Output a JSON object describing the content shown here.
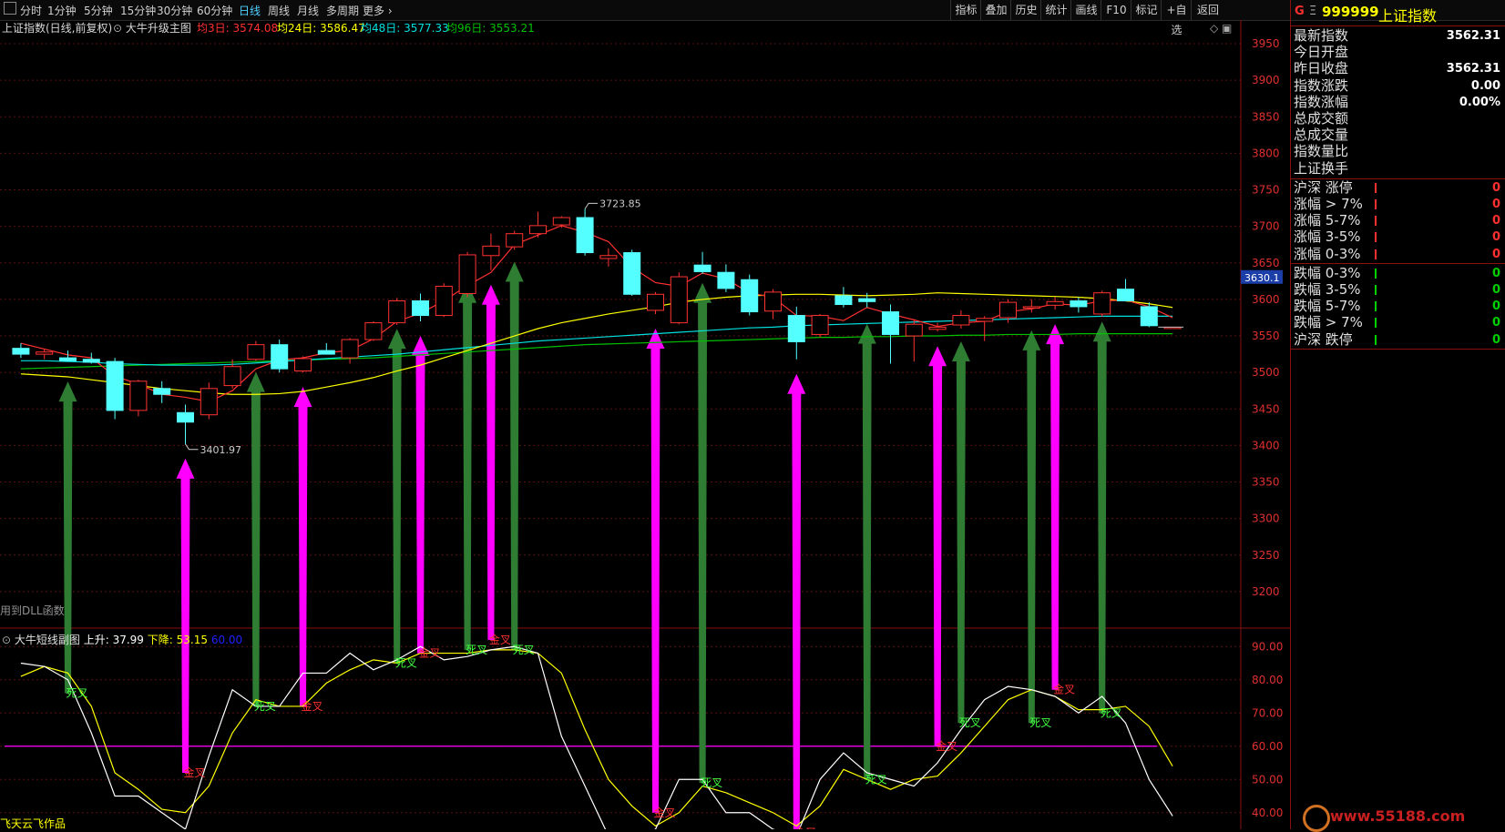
{
  "toolbar": {
    "periods": [
      "分时",
      "1分钟",
      "5分钟",
      "15分钟",
      "30分钟",
      "60分钟",
      "日线",
      "周线",
      "月线",
      "多周期",
      "更多"
    ],
    "active_period": "日线",
    "tools": [
      "指标",
      "叠加",
      "历史",
      "统计",
      "画线",
      "F10",
      "标记",
      "+自选",
      "返回"
    ]
  },
  "main_legend": {
    "index_name": "上证指数(日线,前复权)",
    "template": "大牛升级主图",
    "ma3": "均3日: 3574.08",
    "ma24": "均24日: 3586.47",
    "ma48": "均48日: 3577.33",
    "ma96": "均96日: 3553.21"
  },
  "sub_legend": {
    "name": "大牛短线副图",
    "up": "上升: 37.99",
    "down": "下降: 53.15",
    "level": "60.00"
  },
  "annotations": {
    "high": "3723.85",
    "low": "3401.97",
    "dll_note": "用到DLL函数",
    "author": "飞天云飞作品",
    "price_tag": "3630.1",
    "watermark": "www.55188.com"
  },
  "price_axis": [
    3950,
    3900,
    3850,
    3800,
    3750,
    3700,
    3650,
    3600,
    3550,
    3500,
    3450,
    3400,
    3350,
    3300,
    3250,
    3200
  ],
  "osc_axis": [
    90.0,
    80.0,
    70.0,
    60.0,
    50.0,
    40.0
  ],
  "right_panel": {
    "title_code": "999999",
    "title_name": "上证指数",
    "quote": [
      {
        "label": "最新指数",
        "value": "3562.31"
      },
      {
        "label": "今日开盘",
        "value": ""
      },
      {
        "label": "昨日收盘",
        "value": "3562.31"
      },
      {
        "label": "指数涨跌",
        "value": "0.00"
      },
      {
        "label": "指数涨幅",
        "value": "0.00%"
      },
      {
        "label": "总成交额",
        "value": ""
      },
      {
        "label": "总成交量",
        "value": ""
      },
      {
        "label": "指数量比",
        "value": ""
      },
      {
        "label": "上证换手",
        "value": ""
      }
    ],
    "up_stats": [
      {
        "label": "沪深 涨停",
        "value": "0"
      },
      {
        "label": "涨幅 > 7%",
        "value": "0"
      },
      {
        "label": "涨幅 5-7%",
        "value": "0"
      },
      {
        "label": "涨幅 3-5%",
        "value": "0"
      },
      {
        "label": "涨幅 0-3%",
        "value": "0"
      }
    ],
    "down_stats": [
      {
        "label": "跌幅 0-3%",
        "value": "0"
      },
      {
        "label": "跌幅 3-5%",
        "value": "0"
      },
      {
        "label": "跌幅 5-7%",
        "value": "0"
      },
      {
        "label": "跌幅 > 7%",
        "value": "0"
      },
      {
        "label": "沪深 跌停",
        "value": "0"
      }
    ]
  },
  "colors": {
    "up": "#ff3232",
    "down": "#54ffff",
    "ma3": "#ff3030",
    "ma24": "#ffff00",
    "ma48": "#00e0e0",
    "ma96": "#00c000",
    "golden_arrow": "#ff00ff",
    "dead_arrow": "#2e7d32",
    "osc_up": "#ffffff",
    "osc_down": "#ffff00",
    "level": "#ff00ff"
  },
  "chart_data": {
    "type": "candlestick",
    "candles": [
      {
        "o": 3533,
        "h": 3540,
        "l": 3520,
        "c": 3525
      },
      {
        "o": 3525,
        "h": 3532,
        "l": 3518,
        "c": 3528
      },
      {
        "o": 3520,
        "h": 3530,
        "l": 3515,
        "c": 3516
      },
      {
        "o": 3518,
        "h": 3527,
        "l": 3512,
        "c": 3514
      },
      {
        "o": 3515,
        "h": 3520,
        "l": 3436,
        "c": 3448
      },
      {
        "o": 3448,
        "h": 3490,
        "l": 3440,
        "c": 3488
      },
      {
        "o": 3478,
        "h": 3488,
        "l": 3458,
        "c": 3470
      },
      {
        "o": 3445,
        "h": 3456,
        "l": 3402,
        "c": 3432
      },
      {
        "o": 3442,
        "h": 3486,
        "l": 3436,
        "c": 3478
      },
      {
        "o": 3482,
        "h": 3518,
        "l": 3478,
        "c": 3508
      },
      {
        "o": 3518,
        "h": 3543,
        "l": 3516,
        "c": 3538
      },
      {
        "o": 3538,
        "h": 3545,
        "l": 3500,
        "c": 3505
      },
      {
        "o": 3502,
        "h": 3522,
        "l": 3500,
        "c": 3519
      },
      {
        "o": 3530,
        "h": 3540,
        "l": 3525,
        "c": 3525
      },
      {
        "o": 3520,
        "h": 3547,
        "l": 3512,
        "c": 3545
      },
      {
        "o": 3545,
        "h": 3570,
        "l": 3543,
        "c": 3568
      },
      {
        "o": 3568,
        "h": 3602,
        "l": 3565,
        "c": 3598
      },
      {
        "o": 3598,
        "h": 3608,
        "l": 3570,
        "c": 3578
      },
      {
        "o": 3578,
        "h": 3622,
        "l": 3576,
        "c": 3618
      },
      {
        "o": 3608,
        "h": 3665,
        "l": 3603,
        "c": 3661
      },
      {
        "o": 3660,
        "h": 3690,
        "l": 3640,
        "c": 3673
      },
      {
        "o": 3672,
        "h": 3694,
        "l": 3668,
        "c": 3690
      },
      {
        "o": 3690,
        "h": 3720,
        "l": 3685,
        "c": 3701
      },
      {
        "o": 3702,
        "h": 3714,
        "l": 3698,
        "c": 3712
      },
      {
        "o": 3712,
        "h": 3724,
        "l": 3660,
        "c": 3664
      },
      {
        "o": 3656,
        "h": 3670,
        "l": 3645,
        "c": 3660
      },
      {
        "o": 3664,
        "h": 3668,
        "l": 3605,
        "c": 3607
      },
      {
        "o": 3585,
        "h": 3610,
        "l": 3580,
        "c": 3607
      },
      {
        "o": 3568,
        "h": 3637,
        "l": 3566,
        "c": 3631
      },
      {
        "o": 3647,
        "h": 3665,
        "l": 3635,
        "c": 3638
      },
      {
        "o": 3637,
        "h": 3648,
        "l": 3610,
        "c": 3615
      },
      {
        "o": 3627,
        "h": 3634,
        "l": 3578,
        "c": 3583
      },
      {
        "o": 3584,
        "h": 3614,
        "l": 3573,
        "c": 3610
      },
      {
        "o": 3578,
        "h": 3590,
        "l": 3518,
        "c": 3542
      },
      {
        "o": 3552,
        "h": 3580,
        "l": 3548,
        "c": 3578
      },
      {
        "o": 3605,
        "h": 3617,
        "l": 3589,
        "c": 3593
      },
      {
        "o": 3601,
        "h": 3609,
        "l": 3589,
        "c": 3597
      },
      {
        "o": 3583,
        "h": 3593,
        "l": 3512,
        "c": 3552
      },
      {
        "o": 3550,
        "h": 3573,
        "l": 3515,
        "c": 3566
      },
      {
        "o": 3559,
        "h": 3568,
        "l": 3556,
        "c": 3562
      },
      {
        "o": 3565,
        "h": 3585,
        "l": 3560,
        "c": 3578
      },
      {
        "o": 3570,
        "h": 3577,
        "l": 3543,
        "c": 3574
      },
      {
        "o": 3575,
        "h": 3600,
        "l": 3568,
        "c": 3596
      },
      {
        "o": 3588,
        "h": 3600,
        "l": 3582,
        "c": 3590
      },
      {
        "o": 3592,
        "h": 3603,
        "l": 3586,
        "c": 3597
      },
      {
        "o": 3598,
        "h": 3603,
        "l": 3582,
        "c": 3590
      },
      {
        "o": 3580,
        "h": 3612,
        "l": 3576,
        "c": 3609
      },
      {
        "o": 3614,
        "h": 3628,
        "l": 3600,
        "c": 3598
      },
      {
        "o": 3590,
        "h": 3596,
        "l": 3562,
        "c": 3564
      },
      {
        "o": 3562,
        "h": 3562,
        "l": 3562,
        "c": 3562
      }
    ],
    "ma3": [
      3540,
      3532,
      3524,
      3520,
      3495,
      3484,
      3470,
      3466,
      3460,
      3475,
      3505,
      3517,
      3520,
      3527,
      3530,
      3546,
      3570,
      3581,
      3598,
      3619,
      3637,
      3675,
      3688,
      3701,
      3692,
      3679,
      3644,
      3623,
      3618,
      3636,
      3628,
      3609,
      3603,
      3578,
      3577,
      3571,
      3589,
      3580,
      3572,
      3563,
      3568,
      3570,
      3583,
      3587,
      3594,
      3592,
      3598,
      3599,
      3590,
      3575
    ],
    "ma24": [
      3498,
      3496,
      3494,
      3490,
      3486,
      3482,
      3478,
      3475,
      3472,
      3470,
      3470,
      3471,
      3474,
      3480,
      3486,
      3493,
      3502,
      3510,
      3520,
      3530,
      3540,
      3550,
      3560,
      3568,
      3574,
      3580,
      3585,
      3590,
      3596,
      3600,
      3603,
      3605,
      3606,
      3607,
      3607,
      3606,
      3605,
      3606,
      3607,
      3609,
      3608,
      3607,
      3606,
      3605,
      3604,
      3603,
      3601,
      3598,
      3594,
      3589
    ],
    "ma48": [
      3516,
      3516,
      3515,
      3514,
      3512,
      3511,
      3510,
      3510,
      3510,
      3511,
      3513,
      3515,
      3517,
      3519,
      3521,
      3523,
      3525,
      3528,
      3531,
      3534,
      3537,
      3540,
      3543,
      3545,
      3547,
      3549,
      3551,
      3553,
      3555,
      3557,
      3559,
      3561,
      3562,
      3564,
      3565,
      3566,
      3567,
      3568,
      3569,
      3570,
      3571,
      3572,
      3573,
      3574,
      3575,
      3576,
      3577,
      3577,
      3577,
      3577
    ],
    "ma96": [
      3505,
      3506,
      3507,
      3508,
      3509,
      3510,
      3511,
      3512,
      3513,
      3514,
      3515,
      3516,
      3517,
      3518,
      3519,
      3520,
      3522,
      3524,
      3526,
      3528,
      3530,
      3532,
      3534,
      3536,
      3538,
      3539,
      3540,
      3541,
      3542,
      3543,
      3544,
      3545,
      3546,
      3547,
      3548,
      3548,
      3549,
      3549,
      3550,
      3550,
      3551,
      3551,
      3552,
      3552,
      3552,
      3553,
      3553,
      3553,
      3553,
      3553
    ],
    "osc_up": [
      85,
      84,
      80,
      64,
      45,
      45,
      40,
      35,
      57,
      77,
      72,
      72,
      82,
      82,
      88,
      83,
      86,
      90,
      86,
      87,
      89,
      90,
      88,
      63,
      48,
      33,
      32,
      35,
      50,
      50,
      40,
      40,
      35,
      33,
      50,
      58,
      52,
      50,
      48,
      55,
      65,
      74,
      78,
      77,
      75,
      70,
      75,
      67,
      50,
      39
    ],
    "osc_down": [
      81,
      84,
      82,
      72,
      52,
      47,
      41,
      40,
      48,
      64,
      74,
      72,
      72,
      79,
      83,
      86,
      85,
      88,
      88,
      88,
      89,
      89,
      88,
      82,
      65,
      50,
      42,
      36,
      40,
      48,
      46,
      43,
      40,
      36,
      42,
      53,
      50,
      47,
      50,
      51,
      58,
      66,
      74,
      77,
      75,
      71,
      71,
      72,
      66,
      54
    ],
    "signals": [
      {
        "i": 2,
        "type": "dead",
        "text": "死叉",
        "osc": 76
      },
      {
        "i": 7,
        "type": "golden",
        "text": "金叉",
        "osc": 52
      },
      {
        "i": 10,
        "type": "dead",
        "text": "死叉",
        "osc": 72
      },
      {
        "i": 12,
        "type": "golden",
        "text": "金叉",
        "osc": 72
      },
      {
        "i": 16,
        "type": "dead",
        "text": "死叉",
        "osc": 85
      },
      {
        "i": 17,
        "type": "golden",
        "text": "金叉",
        "osc": 88
      },
      {
        "i": 19,
        "type": "dead",
        "text": "死叉",
        "osc": 89
      },
      {
        "i": 20,
        "type": "golden",
        "text": "金叉",
        "osc": 92
      },
      {
        "i": 21,
        "type": "dead",
        "text": "死叉",
        "osc": 89
      },
      {
        "i": 27,
        "type": "golden",
        "text": "金叉",
        "osc": 40
      },
      {
        "i": 29,
        "type": "dead",
        "text": "死叉",
        "osc": 49
      },
      {
        "i": 33,
        "type": "golden",
        "text": "金叉",
        "osc": 34
      },
      {
        "i": 36,
        "type": "dead",
        "text": "死叉",
        "osc": 50
      },
      {
        "i": 39,
        "type": "golden",
        "text": "金叉",
        "osc": 60
      },
      {
        "i": 40,
        "type": "dead",
        "text": "死叉",
        "osc": 67
      },
      {
        "i": 43,
        "type": "dead",
        "text": "死叉",
        "osc": 67
      },
      {
        "i": 44,
        "type": "golden",
        "text": "金叉",
        "osc": 77
      },
      {
        "i": 46,
        "type": "dead",
        "text": "死叉",
        "osc": 70
      }
    ],
    "price_range": [
      3150,
      3975
    ],
    "osc_range": [
      35,
      95
    ]
  }
}
